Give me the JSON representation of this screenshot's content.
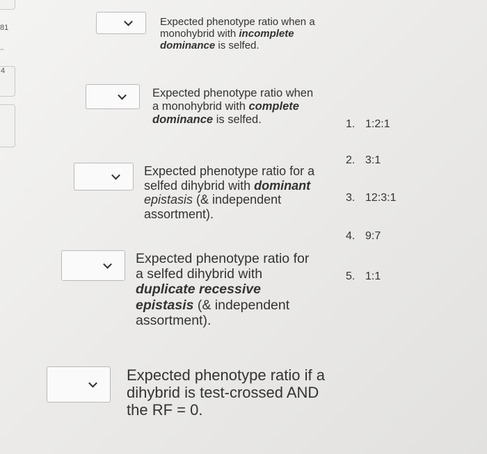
{
  "sidebar": {
    "number_top": "81",
    "number_mid": "4"
  },
  "questions": [
    {
      "dropdown_value": "",
      "pre": "Expected phenotype ratio when a monohybrid with ",
      "emphasis": "incomplete dominance",
      "post": " is selfed."
    },
    {
      "dropdown_value": "",
      "pre": "Expected phenotype ratio when a monohybrid with ",
      "emphasis": "complete dominance",
      "post": " is selfed."
    },
    {
      "dropdown_value": "",
      "pre": "Expected phenotype ratio for a selfed dihybrid with ",
      "emphasis_bold": "dominant",
      "emphasis": " epistasis",
      "post": " (& independent assortment)."
    },
    {
      "dropdown_value": "",
      "pre": "Expected phenotype ratio for a selfed dihybrid with ",
      "emphasis": "duplicate recessive epistasis",
      "post": " (& independent assortment)."
    },
    {
      "dropdown_value": "",
      "text": "Expected phenotype ratio if a dihybrid is test-crossed AND the RF = 0."
    }
  ],
  "choices": [
    {
      "num": "1.",
      "ratio": "1:2:1"
    },
    {
      "num": "2.",
      "ratio": "3:1"
    },
    {
      "num": "3.",
      "ratio": "12:3:1"
    },
    {
      "num": "4.",
      "ratio": "9:7"
    },
    {
      "num": "5.",
      "ratio": "1:1"
    }
  ]
}
